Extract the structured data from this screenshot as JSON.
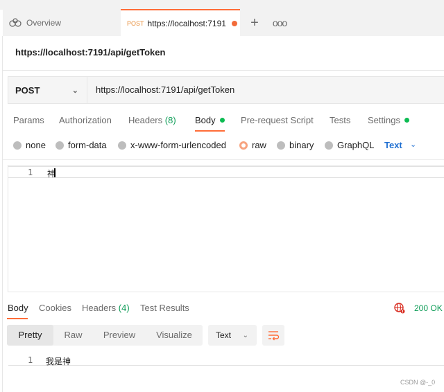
{
  "tabs": {
    "overview_label": "Overview",
    "active_method": "POST",
    "active_url": "https://localhost:7191",
    "more": "ooo"
  },
  "request": {
    "title": "https://localhost:7191/api/getToken",
    "method": "POST",
    "url": "https://localhost:7191/api/getToken"
  },
  "request_tabs": {
    "params": "Params",
    "authorization": "Authorization",
    "headers": "Headers",
    "headers_count": "(8)",
    "body": "Body",
    "prerequest": "Pre-request Script",
    "tests": "Tests",
    "settings": "Settings"
  },
  "body_types": {
    "none": "none",
    "form_data": "form-data",
    "urlencoded": "x-www-form-urlencoded",
    "raw": "raw",
    "binary": "binary",
    "graphql": "GraphQL",
    "selected": "raw",
    "language": "Text"
  },
  "editor": {
    "line_number": "1",
    "content": "神"
  },
  "response": {
    "tabs": {
      "body": "Body",
      "cookies": "Cookies",
      "headers": "Headers",
      "headers_count": "(4)",
      "test_results": "Test Results"
    },
    "status": "200 OK",
    "formats": [
      "Pretty",
      "Raw",
      "Preview",
      "Visualize"
    ],
    "active_format": "Pretty",
    "language": "Text",
    "line_number": "1",
    "content": "我是神"
  },
  "watermark": "CSDN @-_0",
  "colors": {
    "accent": "#ff6c37",
    "success": "#0f9d58",
    "link": "#1f6fd1"
  }
}
